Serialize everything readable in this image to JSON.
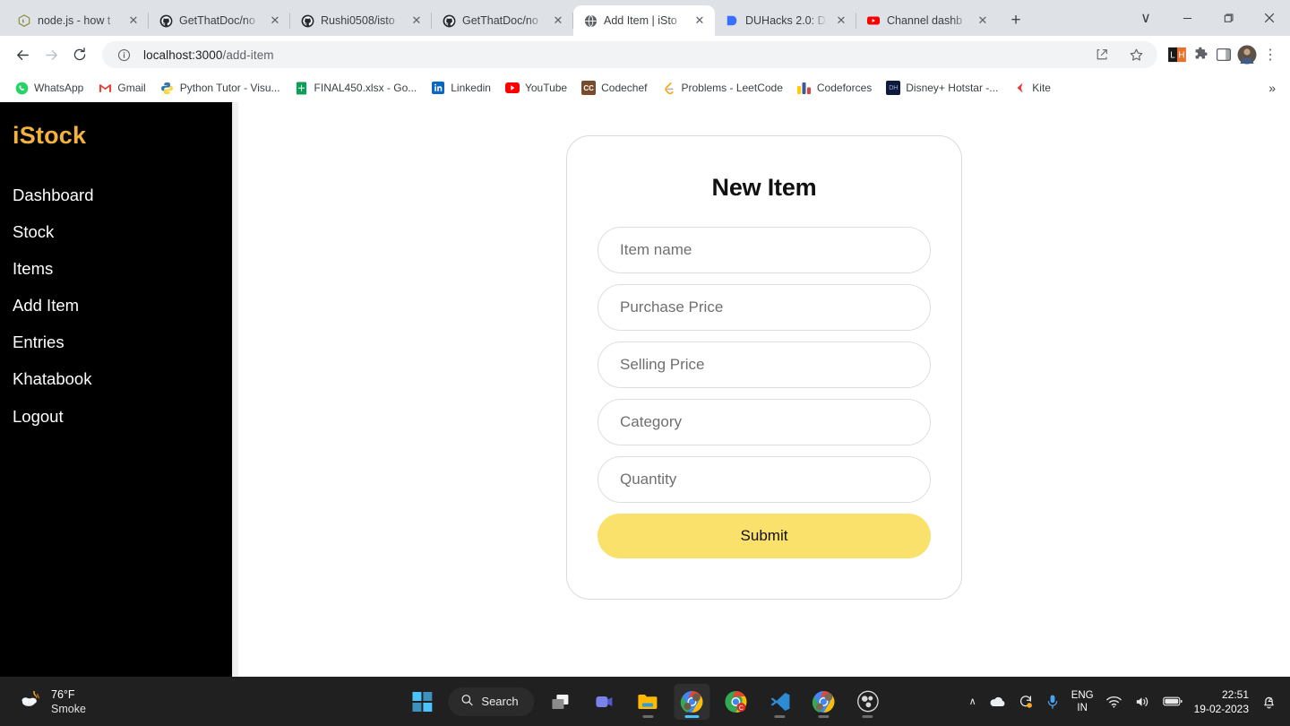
{
  "browser": {
    "tabs": [
      {
        "title": "node.js - how t",
        "favicon": "nodejs-icon",
        "active": false
      },
      {
        "title": "GetThatDoc/no",
        "favicon": "github-icon",
        "active": false
      },
      {
        "title": "Rushi0508/isto",
        "favicon": "github-icon",
        "active": false
      },
      {
        "title": "GetThatDoc/no",
        "favicon": "github-icon",
        "active": false
      },
      {
        "title": "Add Item | iSto",
        "favicon": "globe-icon",
        "active": true
      },
      {
        "title": "DUHacks 2.0: D",
        "favicon": "devfolio-icon",
        "active": false
      },
      {
        "title": "Channel dashb",
        "favicon": "youtube-icon",
        "active": false
      }
    ],
    "new_tab_label": "+",
    "window_controls": {
      "minimize": "–",
      "maximize": "❐",
      "close": "✕",
      "list_tabs": "∨"
    },
    "toolbar": {
      "back": "←",
      "forward": "→",
      "reload": "⟳",
      "url_host": "localhost:3000",
      "url_path": "/add-item",
      "site_info": "info-icon",
      "share": "share-icon",
      "bookmark_star": "star-icon",
      "extensions": [
        "lighthouse-extension-icon",
        "puzzle-extension-icon",
        "sidepanel-icon"
      ],
      "profile": "profile-avatar",
      "menu": "⋮"
    },
    "bookmarks": [
      {
        "label": "WhatsApp",
        "icon": "whatsapp-icon",
        "color": "#25D366",
        "glyph": "✆"
      },
      {
        "label": "Gmail",
        "icon": "gmail-icon",
        "color": "#EA4335",
        "glyph": "M"
      },
      {
        "label": "Python Tutor - Visu...",
        "icon": "python-icon",
        "color": "#3776AB",
        "glyph": "🐍"
      },
      {
        "label": "FINAL450.xlsx - Go...",
        "icon": "google-sheets-icon",
        "color": "#0F9D58",
        "glyph": "✚"
      },
      {
        "label": "Linkedin",
        "icon": "linkedin-icon",
        "color": "#0A66C2",
        "glyph": "in"
      },
      {
        "label": "YouTube",
        "icon": "youtube-icon",
        "color": "#FF0000",
        "glyph": "▶"
      },
      {
        "label": "Codechef",
        "icon": "codechef-icon",
        "color": "#7A4B2A",
        "glyph": "CC"
      },
      {
        "label": "Problems - LeetCode",
        "icon": "leetcode-icon",
        "color": "#FFA116",
        "glyph": "C"
      },
      {
        "label": "Codeforces",
        "icon": "codeforces-icon",
        "color": "#1F8ACB",
        "glyph": "▐"
      },
      {
        "label": "Disney+ Hotstar -...",
        "icon": "hotstar-icon",
        "color": "#0F1B3C",
        "glyph": "་"
      },
      {
        "label": "Kite",
        "icon": "kite-icon",
        "color": "#E8383D",
        "glyph": "◀"
      }
    ],
    "bookmarks_overflow": "»"
  },
  "sidebar": {
    "brand": "iStock",
    "brand_color": "#f2b33d",
    "items": [
      {
        "label": "Dashboard"
      },
      {
        "label": "Stock"
      },
      {
        "label": "Items"
      },
      {
        "label": "Add Item"
      },
      {
        "label": "Entries"
      },
      {
        "label": "Khatabook"
      },
      {
        "label": "Logout"
      }
    ]
  },
  "form": {
    "title": "New Item",
    "fields": [
      {
        "name": "item-name",
        "placeholder": "Item name",
        "value": ""
      },
      {
        "name": "purchase-price",
        "placeholder": "Purchase Price",
        "value": ""
      },
      {
        "name": "selling-price",
        "placeholder": "Selling Price",
        "value": ""
      },
      {
        "name": "category",
        "placeholder": "Category",
        "value": ""
      },
      {
        "name": "quantity",
        "placeholder": "Quantity",
        "value": ""
      }
    ],
    "submit_label": "Submit",
    "submit_color": "#fae16b"
  },
  "taskbar": {
    "weather": {
      "temperature": "76°F",
      "condition": "Smoke",
      "icon": "smoke-weather-icon"
    },
    "start_label": "start-button",
    "search_label": "Search",
    "apps": [
      {
        "name": "task-view-icon",
        "active": false,
        "running": false
      },
      {
        "name": "microsoft-teams-icon",
        "active": false,
        "running": false
      },
      {
        "name": "file-explorer-icon",
        "active": false,
        "running": true
      },
      {
        "name": "google-chrome-icon",
        "active": true,
        "running": true
      },
      {
        "name": "google-chrome-canary-icon",
        "active": false,
        "running": false
      },
      {
        "name": "vs-code-icon",
        "active": false,
        "running": true
      },
      {
        "name": "google-chrome-beta-icon",
        "active": false,
        "running": true
      },
      {
        "name": "obs-studio-icon",
        "active": false,
        "running": true
      }
    ],
    "tray": {
      "chevron": "∧",
      "onedrive": "onedrive-icon",
      "update": "windows-update-icon",
      "microphone": "microphone-icon",
      "language_top": "ENG",
      "language_bottom": "IN",
      "wifi": "wifi-icon",
      "volume": "volume-icon",
      "battery": "battery-icon",
      "time": "22:51",
      "date": "19-02-2023",
      "notifications": "notification-bell-icon"
    }
  }
}
